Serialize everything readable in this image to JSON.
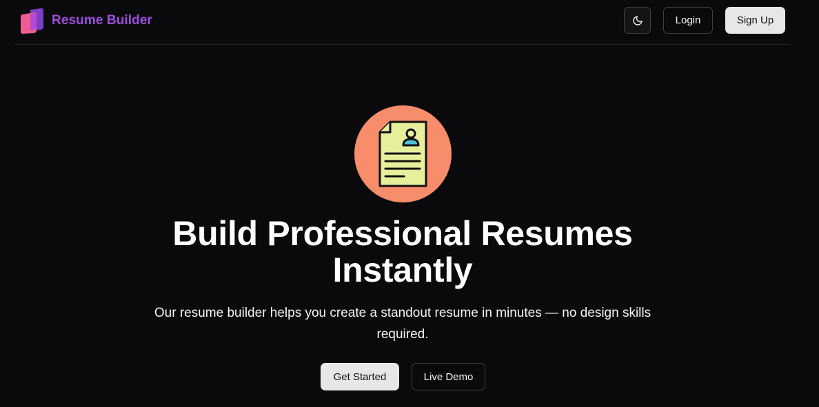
{
  "navbar": {
    "brand": {
      "name": "Resume Builder",
      "logo_icon": "layered-pages-logo-icon",
      "color": "#9d4edd"
    },
    "theme_toggle": {
      "icon": "moon-icon"
    },
    "login_label": "Login",
    "signup_label": "Sign Up"
  },
  "hero": {
    "icon": "resume-document-icon",
    "icon_bg_color": "#f78d6a",
    "icon_doc_color": "#e7ef9b",
    "title": "Build Professional Resumes Instantly",
    "subtitle": "Our resume builder helps you create a standout resume in minutes — no design skills required.",
    "primary_cta": "Get Started",
    "secondary_cta": "Live Demo"
  },
  "colors": {
    "background": "#0a0a0c",
    "border": "#27272a",
    "button_light": "#e7e7e9"
  }
}
